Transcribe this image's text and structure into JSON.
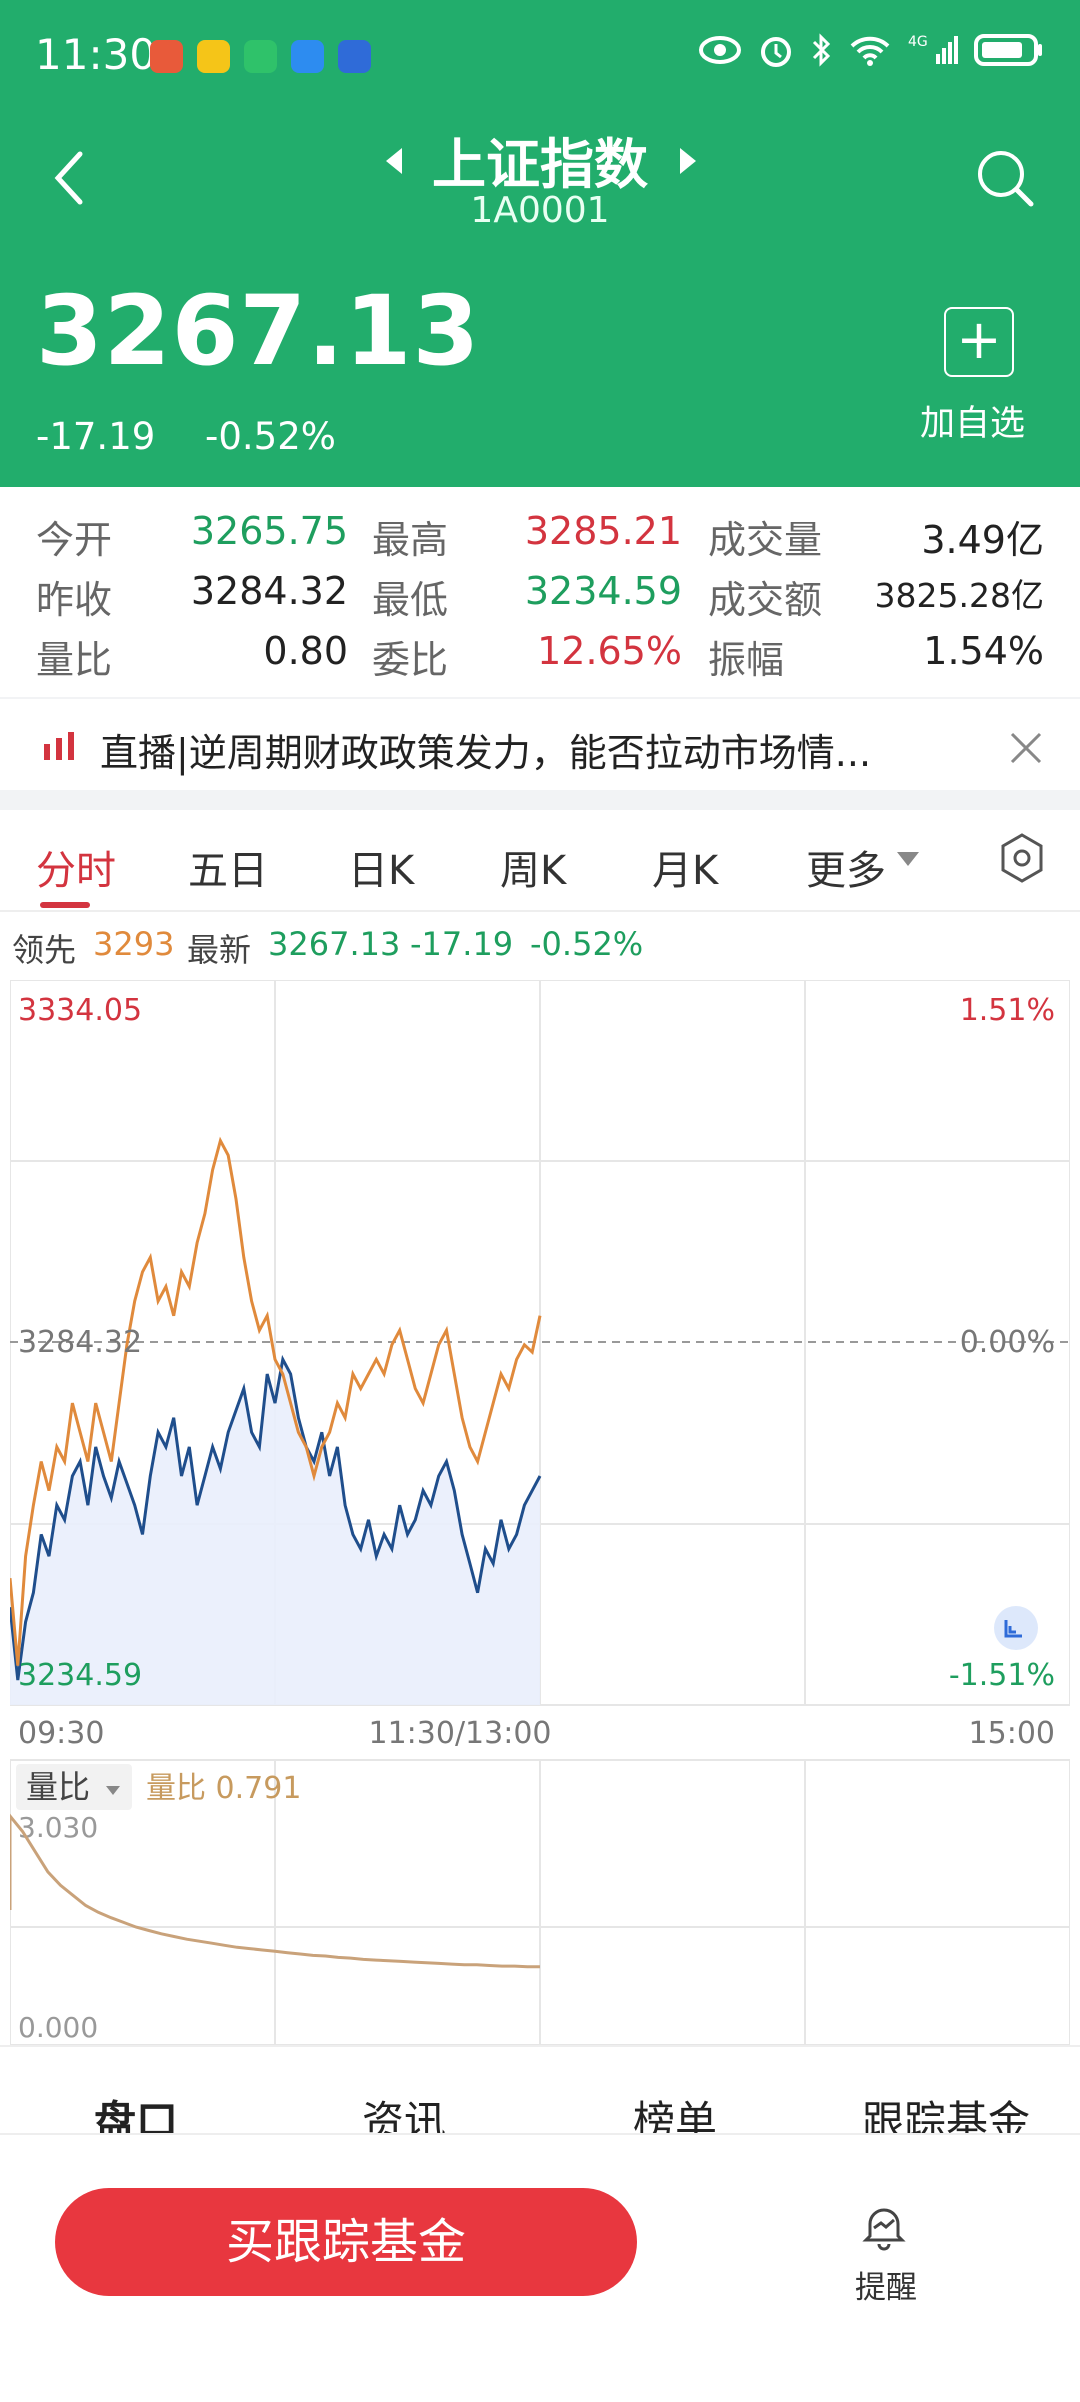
{
  "status_bar": {
    "time": "11:30"
  },
  "header": {
    "title": "上证指数",
    "code": "1A0001",
    "price": "3267.13",
    "change": "-17.19",
    "change_pct": "-0.52%",
    "add_label": "加自选",
    "colors": {
      "bg": "#22ad6c"
    }
  },
  "stats": [
    [
      {
        "label": "今开",
        "value": "3265.75",
        "color": "green"
      },
      {
        "label": "最高",
        "value": "3285.21",
        "color": "red"
      },
      {
        "label": "成交量",
        "value": "3.49亿",
        "color": "blk"
      }
    ],
    [
      {
        "label": "昨收",
        "value": "3284.32",
        "color": "blk"
      },
      {
        "label": "最低",
        "value": "3234.59",
        "color": "green"
      },
      {
        "label": "成交额",
        "value": "3825.28亿",
        "color": "blk"
      }
    ],
    [
      {
        "label": "量比",
        "value": "0.80",
        "color": "blk"
      },
      {
        "label": "委比",
        "value": "12.65%",
        "color": "red"
      },
      {
        "label": "振幅",
        "value": "1.54%",
        "color": "blk"
      }
    ]
  ],
  "news": {
    "text": "直播|逆周期财政政策发力，能否拉动市场情..."
  },
  "tabs": [
    "分时",
    "五日",
    "日K",
    "周K",
    "月K",
    "更多"
  ],
  "info_bar": {
    "lead_label": "领先",
    "lead_value": "3293",
    "latest_label": "最新",
    "latest_value": "3267.13",
    "chg": "-17.19",
    "pct": "-0.52%"
  },
  "chart_data": {
    "type": "line",
    "title": "",
    "xlabel": "",
    "ylabel": "",
    "x_ticks": [
      "09:30",
      "11:30/13:00",
      "15:00"
    ],
    "y_left_ticks": [
      "3334.05",
      "3284.32",
      "3234.59"
    ],
    "y_right_ticks": [
      "1.51%",
      "0.00%",
      "-1.51%"
    ],
    "ylim": [
      3234.59,
      3334.05
    ],
    "prev_close": 3284.32,
    "series": [
      {
        "color": "#1f4e8c",
        "values": [
          3248,
          3238,
          3246,
          3250,
          3258,
          3255,
          3262,
          3260,
          3266,
          3268,
          3262,
          3270,
          3266,
          3263,
          3268,
          3265,
          3262,
          3258,
          3266,
          3272,
          3270,
          3274,
          3266,
          3270,
          3262,
          3266,
          3270,
          3267,
          3272,
          3275,
          3278,
          3272,
          3270,
          3280,
          3276,
          3282,
          3280,
          3274,
          3270,
          3268,
          3272,
          3266,
          3270,
          3262,
          3258,
          3256,
          3260,
          3255,
          3258,
          3256,
          3262,
          3258,
          3260,
          3264,
          3262,
          3266,
          3268,
          3264,
          3258,
          3254,
          3250,
          3256,
          3254,
          3260,
          3256,
          3258,
          3262,
          3264,
          3266
        ]
      },
      {
        "color": "#e08a3c",
        "values": [
          3252,
          3240,
          3255,
          3262,
          3268,
          3264,
          3270,
          3268,
          3276,
          3272,
          3268,
          3276,
          3272,
          3268,
          3276,
          3284,
          3290,
          3294,
          3296,
          3290,
          3292,
          3288,
          3294,
          3292,
          3298,
          3302,
          3308,
          3312,
          3310,
          3304,
          3296,
          3290,
          3286,
          3288,
          3282,
          3280,
          3276,
          3272,
          3270,
          3266,
          3270,
          3272,
          3276,
          3274,
          3280,
          3278,
          3280,
          3282,
          3280,
          3284,
          3286,
          3282,
          3278,
          3276,
          3280,
          3284,
          3286,
          3280,
          3274,
          3270,
          3268,
          3272,
          3276,
          3280,
          3278,
          3282,
          3284,
          3283,
          3288
        ]
      }
    ],
    "volume_ratio": {
      "label": "量比",
      "current_label": "量比 0.791",
      "y_ticks": [
        "3.030",
        "0.000"
      ],
      "ylim": [
        0,
        3.03
      ],
      "values": [
        3.03,
        2.8,
        2.5,
        2.2,
        2.0,
        1.85,
        1.7,
        1.6,
        1.52,
        1.45,
        1.38,
        1.33,
        1.28,
        1.24,
        1.2,
        1.17,
        1.14,
        1.11,
        1.08,
        1.06,
        1.04,
        1.02,
        1.0,
        0.98,
        0.96,
        0.95,
        0.93,
        0.92,
        0.9,
        0.89,
        0.88,
        0.87,
        0.86,
        0.85,
        0.84,
        0.83,
        0.82,
        0.82,
        0.81,
        0.8,
        0.8,
        0.79,
        0.79
      ]
    }
  },
  "bottom_tabs": [
    "盘口",
    "资讯",
    "榜单",
    "跟踪基金"
  ],
  "buy_button": "买跟踪基金",
  "remind_label": "提醒"
}
